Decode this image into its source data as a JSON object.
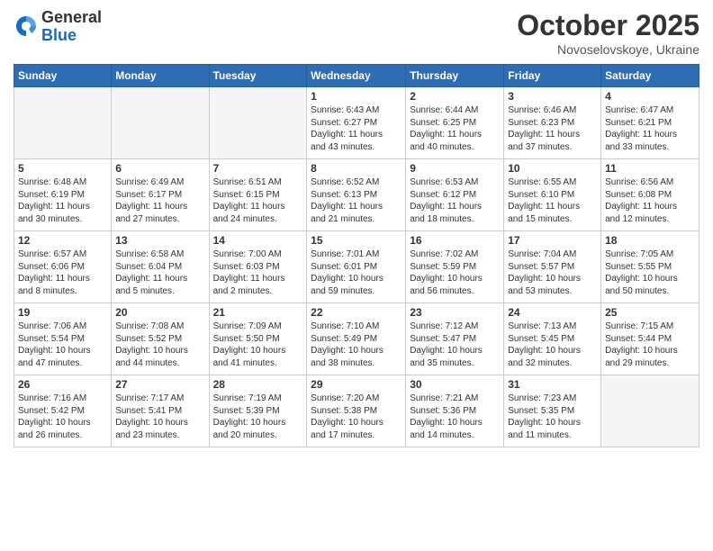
{
  "logo": {
    "general": "General",
    "blue": "Blue"
  },
  "title": "October 2025",
  "subtitle": "Novoselovskoye, Ukraine",
  "days_of_week": [
    "Sunday",
    "Monday",
    "Tuesday",
    "Wednesday",
    "Thursday",
    "Friday",
    "Saturday"
  ],
  "weeks": [
    [
      {
        "day": "",
        "info": ""
      },
      {
        "day": "",
        "info": ""
      },
      {
        "day": "",
        "info": ""
      },
      {
        "day": "1",
        "info": "Sunrise: 6:43 AM\nSunset: 6:27 PM\nDaylight: 11 hours\nand 43 minutes."
      },
      {
        "day": "2",
        "info": "Sunrise: 6:44 AM\nSunset: 6:25 PM\nDaylight: 11 hours\nand 40 minutes."
      },
      {
        "day": "3",
        "info": "Sunrise: 6:46 AM\nSunset: 6:23 PM\nDaylight: 11 hours\nand 37 minutes."
      },
      {
        "day": "4",
        "info": "Sunrise: 6:47 AM\nSunset: 6:21 PM\nDaylight: 11 hours\nand 33 minutes."
      }
    ],
    [
      {
        "day": "5",
        "info": "Sunrise: 6:48 AM\nSunset: 6:19 PM\nDaylight: 11 hours\nand 30 minutes."
      },
      {
        "day": "6",
        "info": "Sunrise: 6:49 AM\nSunset: 6:17 PM\nDaylight: 11 hours\nand 27 minutes."
      },
      {
        "day": "7",
        "info": "Sunrise: 6:51 AM\nSunset: 6:15 PM\nDaylight: 11 hours\nand 24 minutes."
      },
      {
        "day": "8",
        "info": "Sunrise: 6:52 AM\nSunset: 6:13 PM\nDaylight: 11 hours\nand 21 minutes."
      },
      {
        "day": "9",
        "info": "Sunrise: 6:53 AM\nSunset: 6:12 PM\nDaylight: 11 hours\nand 18 minutes."
      },
      {
        "day": "10",
        "info": "Sunrise: 6:55 AM\nSunset: 6:10 PM\nDaylight: 11 hours\nand 15 minutes."
      },
      {
        "day": "11",
        "info": "Sunrise: 6:56 AM\nSunset: 6:08 PM\nDaylight: 11 hours\nand 12 minutes."
      }
    ],
    [
      {
        "day": "12",
        "info": "Sunrise: 6:57 AM\nSunset: 6:06 PM\nDaylight: 11 hours\nand 8 minutes."
      },
      {
        "day": "13",
        "info": "Sunrise: 6:58 AM\nSunset: 6:04 PM\nDaylight: 11 hours\nand 5 minutes."
      },
      {
        "day": "14",
        "info": "Sunrise: 7:00 AM\nSunset: 6:03 PM\nDaylight: 11 hours\nand 2 minutes."
      },
      {
        "day": "15",
        "info": "Sunrise: 7:01 AM\nSunset: 6:01 PM\nDaylight: 10 hours\nand 59 minutes."
      },
      {
        "day": "16",
        "info": "Sunrise: 7:02 AM\nSunset: 5:59 PM\nDaylight: 10 hours\nand 56 minutes."
      },
      {
        "day": "17",
        "info": "Sunrise: 7:04 AM\nSunset: 5:57 PM\nDaylight: 10 hours\nand 53 minutes."
      },
      {
        "day": "18",
        "info": "Sunrise: 7:05 AM\nSunset: 5:55 PM\nDaylight: 10 hours\nand 50 minutes."
      }
    ],
    [
      {
        "day": "19",
        "info": "Sunrise: 7:06 AM\nSunset: 5:54 PM\nDaylight: 10 hours\nand 47 minutes."
      },
      {
        "day": "20",
        "info": "Sunrise: 7:08 AM\nSunset: 5:52 PM\nDaylight: 10 hours\nand 44 minutes."
      },
      {
        "day": "21",
        "info": "Sunrise: 7:09 AM\nSunset: 5:50 PM\nDaylight: 10 hours\nand 41 minutes."
      },
      {
        "day": "22",
        "info": "Sunrise: 7:10 AM\nSunset: 5:49 PM\nDaylight: 10 hours\nand 38 minutes."
      },
      {
        "day": "23",
        "info": "Sunrise: 7:12 AM\nSunset: 5:47 PM\nDaylight: 10 hours\nand 35 minutes."
      },
      {
        "day": "24",
        "info": "Sunrise: 7:13 AM\nSunset: 5:45 PM\nDaylight: 10 hours\nand 32 minutes."
      },
      {
        "day": "25",
        "info": "Sunrise: 7:15 AM\nSunset: 5:44 PM\nDaylight: 10 hours\nand 29 minutes."
      }
    ],
    [
      {
        "day": "26",
        "info": "Sunrise: 7:16 AM\nSunset: 5:42 PM\nDaylight: 10 hours\nand 26 minutes."
      },
      {
        "day": "27",
        "info": "Sunrise: 7:17 AM\nSunset: 5:41 PM\nDaylight: 10 hours\nand 23 minutes."
      },
      {
        "day": "28",
        "info": "Sunrise: 7:19 AM\nSunset: 5:39 PM\nDaylight: 10 hours\nand 20 minutes."
      },
      {
        "day": "29",
        "info": "Sunrise: 7:20 AM\nSunset: 5:38 PM\nDaylight: 10 hours\nand 17 minutes."
      },
      {
        "day": "30",
        "info": "Sunrise: 7:21 AM\nSunset: 5:36 PM\nDaylight: 10 hours\nand 14 minutes."
      },
      {
        "day": "31",
        "info": "Sunrise: 7:23 AM\nSunset: 5:35 PM\nDaylight: 10 hours\nand 11 minutes."
      },
      {
        "day": "",
        "info": ""
      }
    ]
  ]
}
